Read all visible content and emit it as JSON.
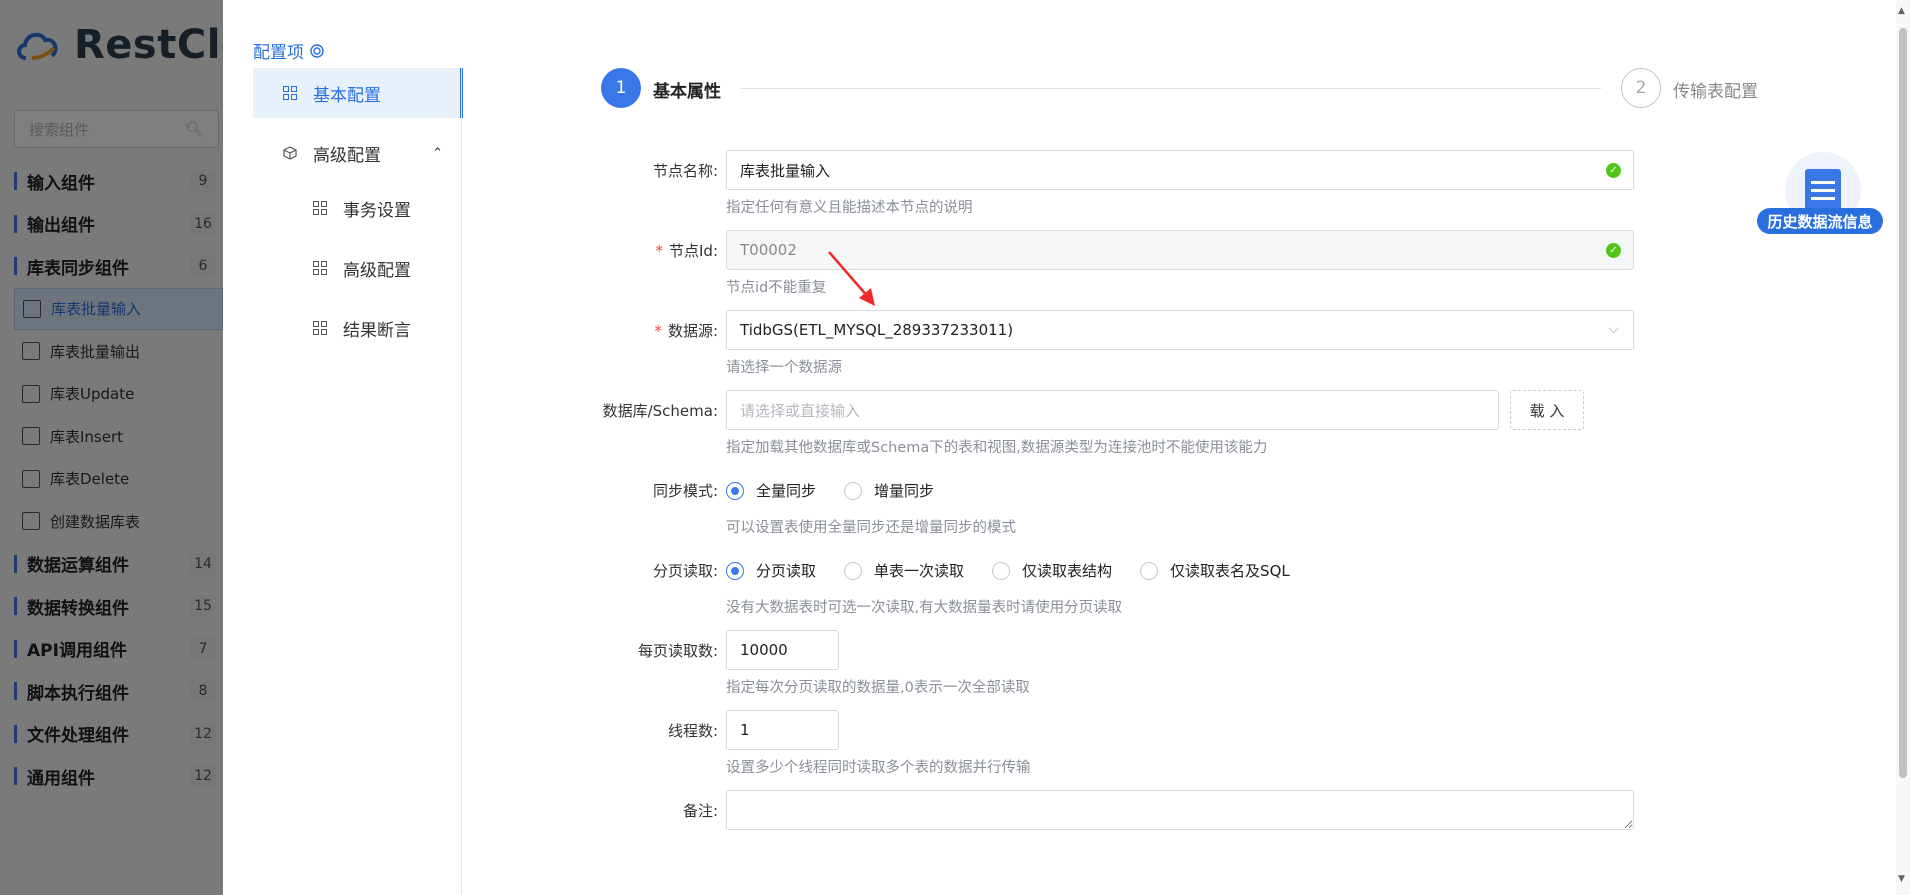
{
  "background": {
    "logo_text": "RestClo",
    "search_placeholder": "搜索组件",
    "categories": [
      {
        "label": "输入组件",
        "count": "9"
      },
      {
        "label": "输出组件",
        "count": "16"
      },
      {
        "label": "库表同步组件",
        "count": "6"
      }
    ],
    "sync_items": [
      "库表批量输入",
      "库表批量输出",
      "库表Update",
      "库表Insert",
      "库表Delete",
      "创建数据库表"
    ],
    "more_categories": [
      {
        "label": "数据运算组件",
        "count": "14"
      },
      {
        "label": "数据转换组件",
        "count": "15"
      },
      {
        "label": "API调用组件",
        "count": "7"
      },
      {
        "label": "脚本执行组件",
        "count": "8"
      },
      {
        "label": "文件处理组件",
        "count": "12"
      },
      {
        "label": "通用组件",
        "count": "12"
      }
    ]
  },
  "drawer": {
    "config_title": "配置项",
    "nav": {
      "basic": "基本配置",
      "advanced_group": "高级配置",
      "transaction": "事务设置",
      "advanced": "高级配置",
      "assertion": "结果断言"
    },
    "steps": {
      "step1_num": "1",
      "step1_label": "基本属性",
      "step2_num": "2",
      "step2_label": "传输表配置"
    },
    "history_label": "历史数据流信息",
    "form": {
      "node_name_label": "节点名称:",
      "node_name_value": "库表批量输入",
      "node_name_hint": "指定任何有意义且能描述本节点的说明",
      "node_id_label": "节点Id:",
      "node_id_value": "T00002",
      "node_id_hint": "节点id不能重复",
      "datasource_label": "数据源:",
      "datasource_value": "TidbGS(ETL_MYSQL_289337233011)",
      "datasource_hint": "请选择一个数据源",
      "schema_label": "数据库/Schema:",
      "schema_placeholder": "请选择或直接输入",
      "load_button": "载 入",
      "schema_hint": "指定加载其他数据库或Schema下的表和视图,数据源类型为连接池时不能使用该能力",
      "sync_mode_label": "同步模式:",
      "sync_full": "全量同步",
      "sync_incremental": "增量同步",
      "sync_hint": "可以设置表使用全量同步还是增量同步的模式",
      "paging_label": "分页读取:",
      "paging_opt1": "分页读取",
      "paging_opt2": "单表一次读取",
      "paging_opt3": "仅读取表结构",
      "paging_opt4": "仅读取表名及SQL",
      "paging_hint": "没有大数据表时可选一次读取,有大数据量表时请使用分页读取",
      "page_size_label": "每页读取数:",
      "page_size_value": "10000",
      "page_size_hint": "指定每次分页读取的数据量,0表示一次全部读取",
      "threads_label": "线程数:",
      "threads_value": "1",
      "threads_hint": "设置多少个线程同时读取多个表的数据并行传输",
      "remark_label": "备注:"
    }
  },
  "colors": {
    "accent": "#3a78e8",
    "required": "#f04848",
    "success": "#52c41a"
  }
}
